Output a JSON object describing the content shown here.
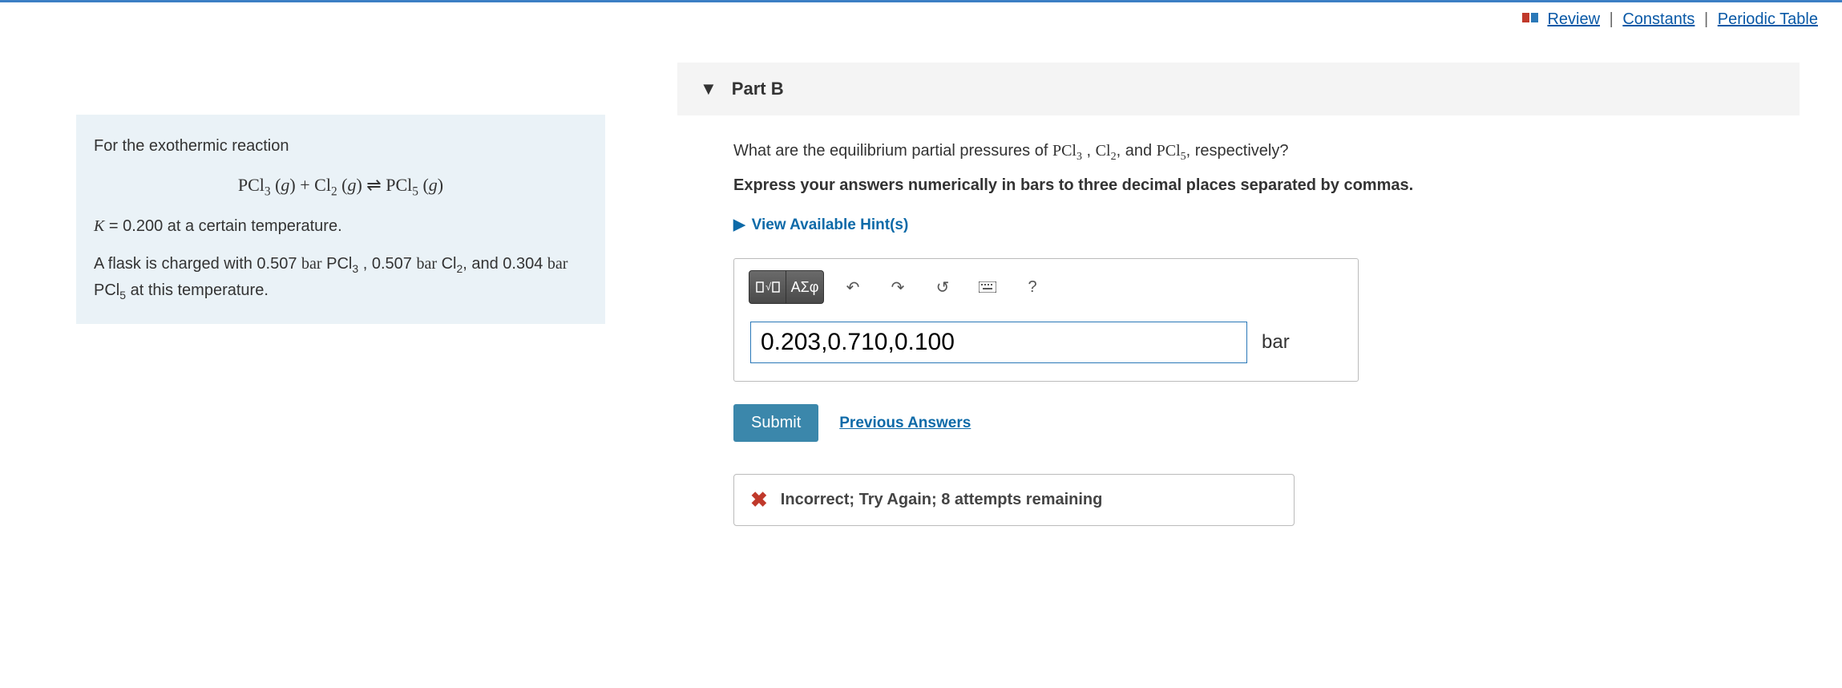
{
  "topbar": {
    "review": "Review",
    "constants": "Constants",
    "periodic_table": "Periodic Table"
  },
  "info": {
    "line1": "For the exothermic reaction",
    "equation_html": "PCl<sub>3</sub> (<span class='ital'>g</span>) + Cl<sub>2</sub> (<span class='ital'>g</span>) ⇌ PCl<sub>5</sub> (<span class='ital'>g</span>)",
    "k_line_html": "<span class='ital serif'>K</span> = 0.200 at a certain temperature.",
    "flask_html": "A flask is charged with 0.507 <span class='serif'>bar</span> PCl<sub>3</sub> , 0.507 <span class='serif'>bar</span> Cl<sub>2</sub>, and 0.304 <span class='serif'>bar</span> PCl<sub>5</sub> at this temperature."
  },
  "part": {
    "header": "Part B",
    "prompt_html": "What are the equilibrium partial pressures of <span class='serif'>PCl<sub>3</sub></span> , <span class='serif'>Cl<sub>2</sub></span>, and <span class='serif'>PCl<sub>5</sub></span>, respectively?",
    "instruction": "Express your answers numerically in bars to three decimal places separated by commas.",
    "hints_label": "View Available Hint(s)",
    "input_value": "0.203,0.710,0.100",
    "unit": "bar",
    "submit_label": "Submit",
    "previous_answers_label": "Previous Answers",
    "feedback": "Incorrect; Try Again; 8 attempts remaining"
  },
  "toolbar": {
    "templates": "▮√▯",
    "greek": "ΑΣφ",
    "undo": "↶",
    "redo": "↷",
    "reset": "↺",
    "keyboard": "⌨",
    "help": "?"
  }
}
